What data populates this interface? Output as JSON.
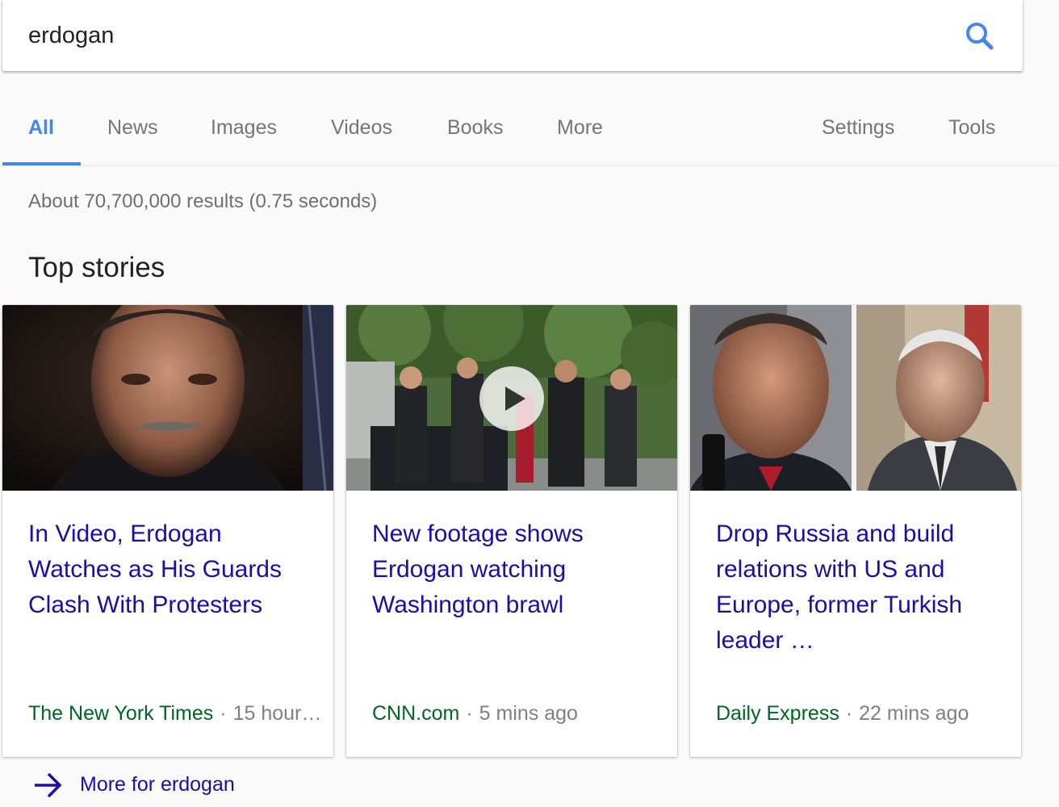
{
  "search": {
    "query": "erdogan",
    "search_icon": "magnifier-icon"
  },
  "tabs": {
    "left": [
      "All",
      "News",
      "Images",
      "Videos",
      "Books",
      "More"
    ],
    "right": [
      "Settings",
      "Tools"
    ],
    "active": "All"
  },
  "result_stats": "About 70,700,000 results (0.75 seconds)",
  "top_stories": {
    "title": "Top stories",
    "cards": [
      {
        "headline": "In Video, Erdogan Watches as His Guards Clash With Protesters",
        "source": "The New York Times",
        "separator": "·",
        "age": "15 hour…",
        "image": "erdogan-portrait"
      },
      {
        "headline": "New footage shows Erdogan watching Washington brawl",
        "source": "CNN.com",
        "separator": "·",
        "age": "5 mins ago",
        "image": "video-thumbnail-brawl",
        "play_icon": "play-icon"
      },
      {
        "headline": "Drop Russia and build relations with US and Europe, former Turkish leader …",
        "source": "Daily Express",
        "separator": "·",
        "age": "22 mins ago",
        "image": "two-politicians-photo"
      }
    ]
  },
  "more_link": {
    "label": "More for erdogan",
    "icon": "arrow-right-icon"
  },
  "colors": {
    "accent": "#4285f4",
    "link": "#1a0dab",
    "source": "#006621",
    "muted": "#808080"
  }
}
